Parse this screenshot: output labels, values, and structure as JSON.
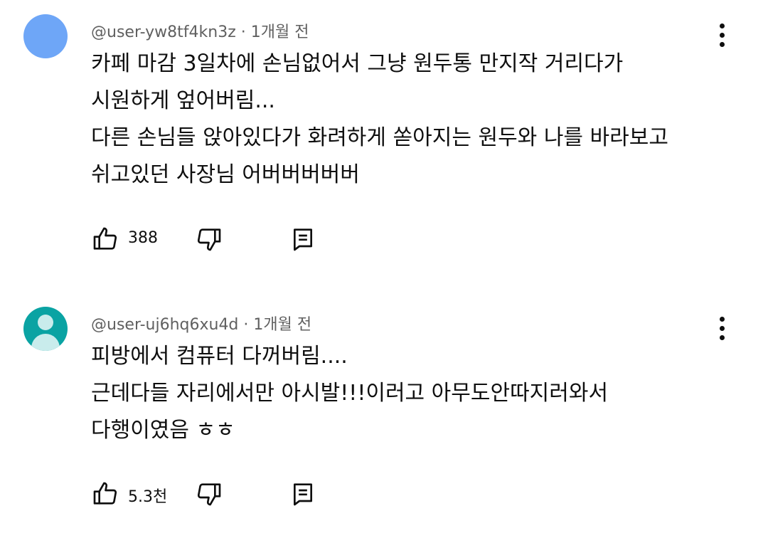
{
  "comments": [
    {
      "author": "@user-yw8tf4kn3z",
      "time_sep": "·",
      "time": "1개월 전",
      "avatar": "blue-circle",
      "lines": [
        "카페 마감 3일차에 손님없어서 그냥 원두통 만지작 거리다가",
        "시원하게 엎어버림...",
        "다른 손님들 앉아있다가 화려하게 쏟아지는 원두와 나를 바라보고",
        "쉬고있던 사장님 어버버버버버"
      ],
      "likes": "388",
      "icons": {
        "like": "thumb-up-icon",
        "dislike": "thumb-down-icon",
        "reply": "comment-icon",
        "more": "more-vert-icon"
      }
    },
    {
      "author": "@user-uj6hq6xu4d",
      "time_sep": "·",
      "time": "1개월 전",
      "avatar": "teal-person",
      "lines": [
        "피방에서 컴퓨터 다꺼버림....",
        "근데다들 자리에서만 아시발!!!이러고 아무도안따지러와서",
        "다행이였음 ㅎㅎ"
      ],
      "likes": "5.3천",
      "icons": {
        "like": "thumb-up-icon",
        "dislike": "thumb-down-icon",
        "reply": "comment-icon",
        "more": "more-vert-icon"
      }
    }
  ]
}
